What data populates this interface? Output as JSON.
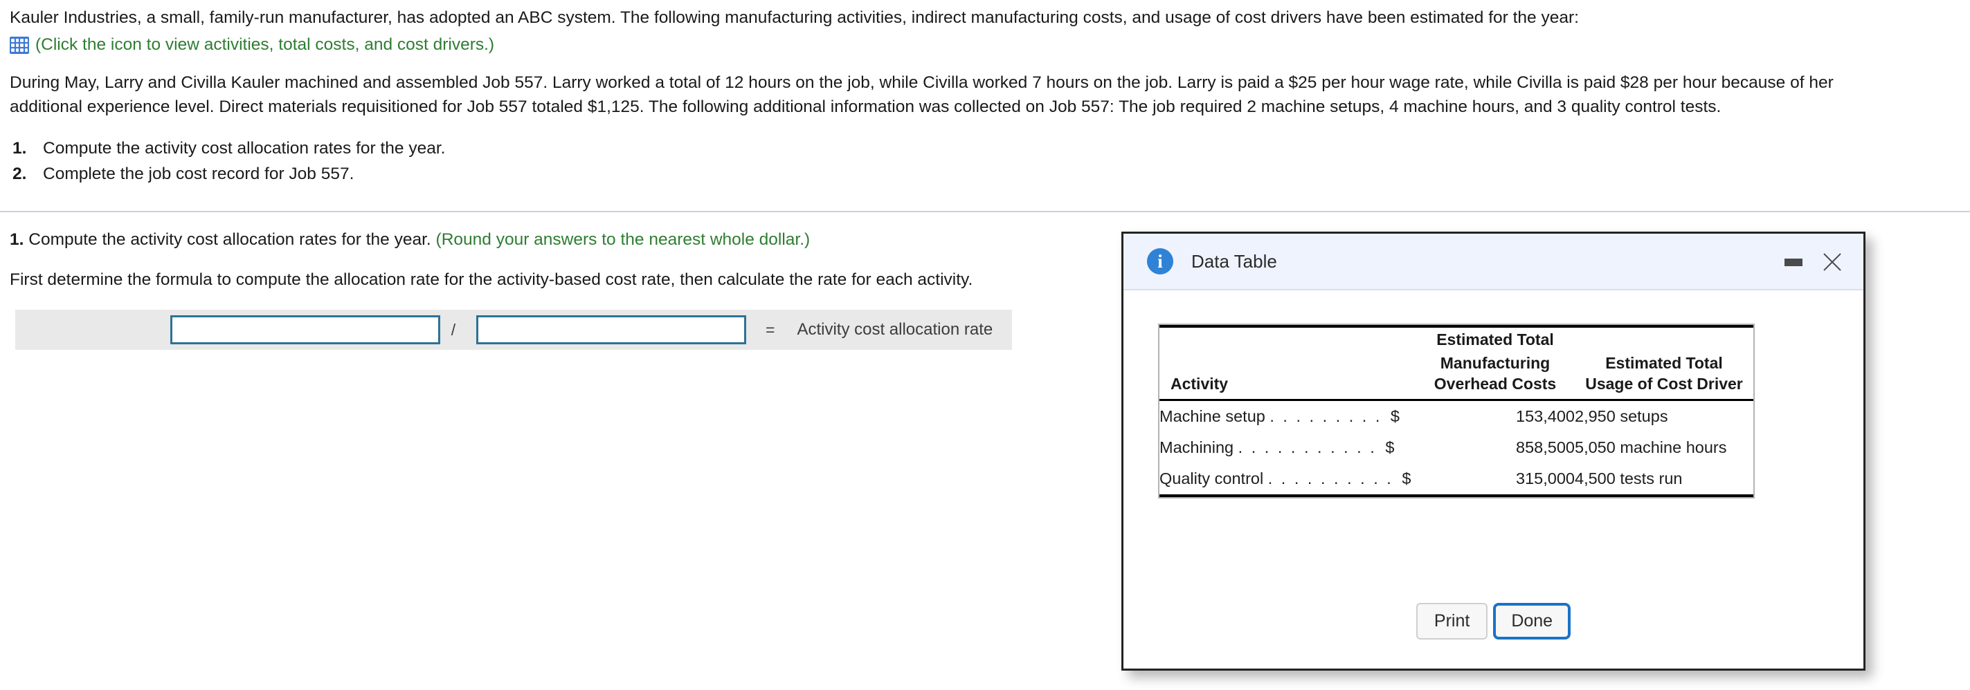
{
  "problem": {
    "intro": "Kauler Industries, a small, family-run manufacturer, has adopted an ABC system. The following manufacturing activities, indirect manufacturing costs, and usage of cost drivers have been estimated for the year:",
    "icon_name": "table-grid-icon",
    "icon_link_text": "(Click the icon to view activities, total costs, and cost drivers.)",
    "paragraph_line1": "During May, Larry and Civilla Kauler machined and assembled Job 557. Larry worked a total of 12 hours on the job, while Civilla worked 7 hours on the job. Larry is paid a $25 per hour wage rate, while Civilla is paid $28 per hour because of her",
    "paragraph_line2": "additional experience level. Direct materials requisitioned for Job 557 totaled $1,125. The following additional information was collected on Job 557: The job required 2 machine setups, 4 machine hours, and 3 quality control tests.",
    "tasks": [
      {
        "number": "1.",
        "text": "Compute the activity cost allocation rates for the year."
      },
      {
        "number": "2.",
        "text": "Complete the job cost record for Job 557."
      }
    ]
  },
  "question": {
    "number": "1.",
    "prompt": "Compute the activity cost allocation rates for the year.",
    "hint": "(Round your answers to the nearest whole dollar.)",
    "instruction": "First determine the formula to compute the allocation rate for the activity-based cost rate, then calculate the rate for each activity.",
    "formula": {
      "numerator_value": "",
      "numerator_placeholder": "",
      "divider_symbol": "/",
      "denominator_value": "",
      "denominator_placeholder": "",
      "equals_symbol": "=",
      "result_label": "Activity cost allocation rate"
    }
  },
  "modal": {
    "title": "Data Table",
    "info_icon": "info-icon",
    "minimize_label": "",
    "close_label": "",
    "buttons": {
      "print": "Print",
      "done": "Done"
    },
    "table": {
      "headers": {
        "col1": "Activity",
        "col2_line1": "Estimated Total",
        "col2_line2": "Manufacturing",
        "col2_line3": "Overhead Costs",
        "col3_line1": "",
        "col3_line2": "Estimated Total",
        "col3_line3": "Usage of Cost Driver"
      },
      "rows": [
        {
          "activity": "Machine setup",
          "leader": ". . . . . . . . .",
          "currency": "$",
          "amount": "153,400",
          "driver": "2,950 setups"
        },
        {
          "activity": "Machining",
          "leader": ". . . . . . . . . . .",
          "currency": "$",
          "amount": "858,500",
          "driver": "5,050 machine hours"
        },
        {
          "activity": "Quality control",
          "leader": ". . . . . . . . . .",
          "currency": "$",
          "amount": "315,000",
          "driver": "4,500 tests run"
        }
      ]
    }
  },
  "colors": {
    "link_green": "#2e7d32",
    "input_border": "#2d7296",
    "formula_bar_bg": "#e9e9e9",
    "modal_header_bg": "#eef3fd",
    "primary_button_border": "#1a73c7",
    "info_icon_bg": "#2f82d6"
  }
}
